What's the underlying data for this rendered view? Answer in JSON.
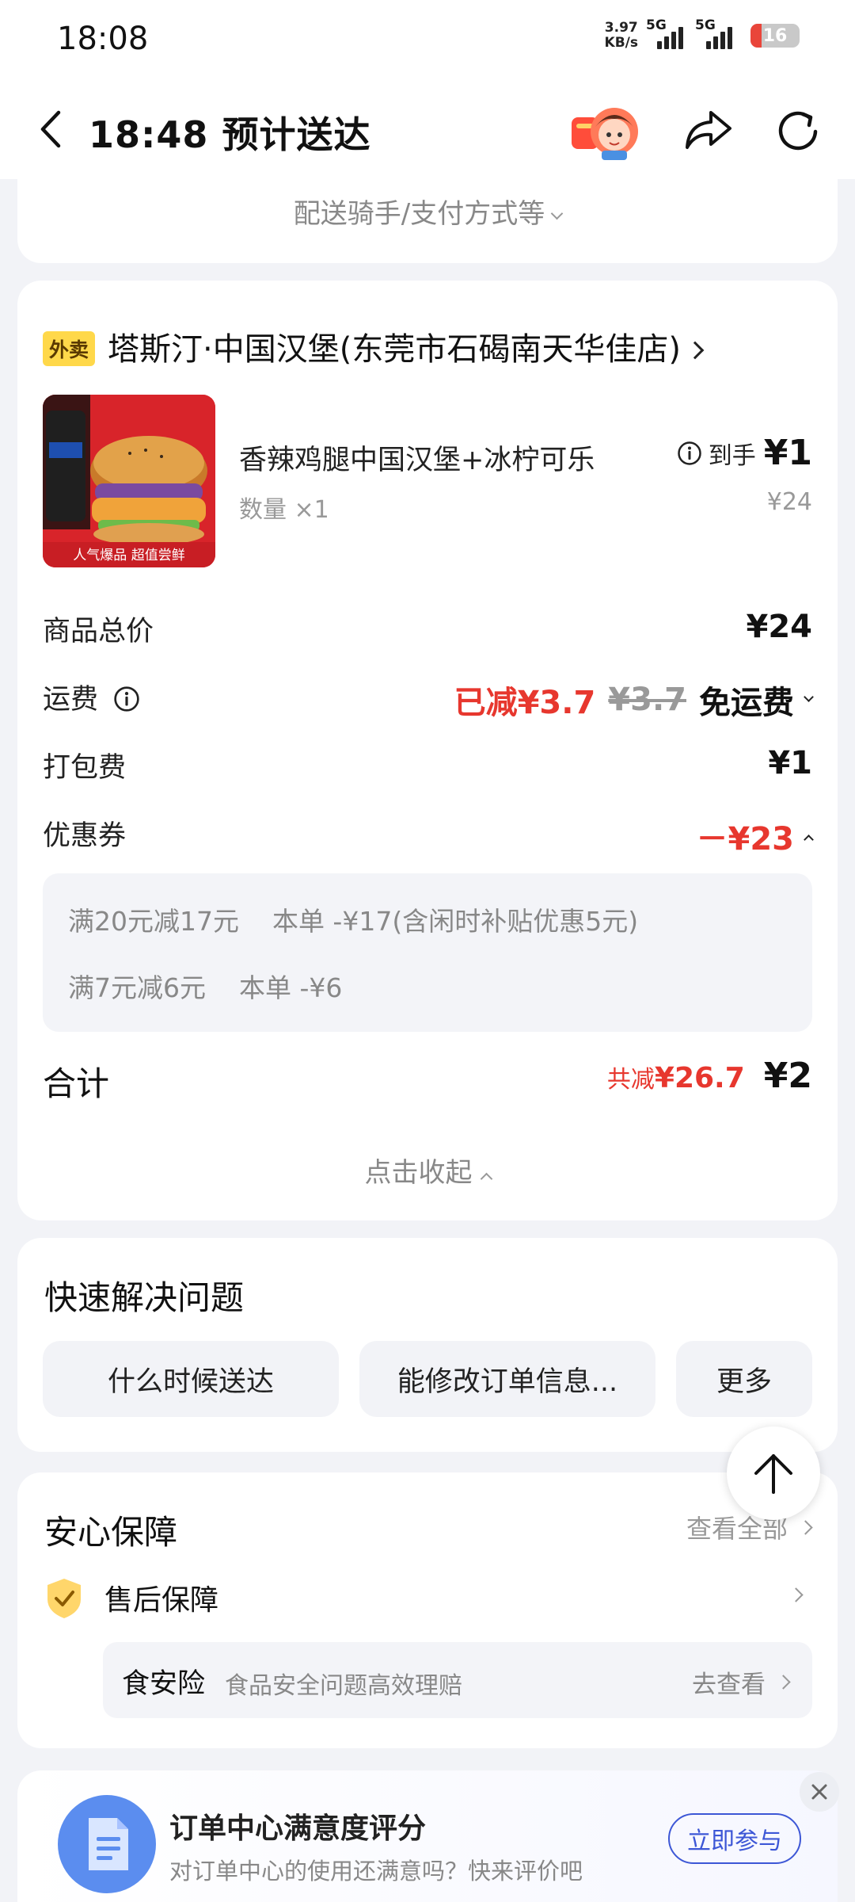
{
  "status_bar": {
    "time": "18:08",
    "net_speed_value": "3.97",
    "net_speed_unit": "KB/s",
    "signal_1": "5G",
    "signal_2": "5G",
    "battery": "16"
  },
  "header": {
    "title": "18:48 预计送达"
  },
  "delivery_info": {
    "more_label": "配送骑手/支付方式等"
  },
  "order": {
    "tag": "外卖",
    "store_name": "塔斯汀·中国汉堡(东莞市石碣南天华佳店)",
    "product": {
      "name": "香辣鸡腿中国汉堡+冰柠可乐",
      "quantity": "数量 ×1",
      "final_label": "到手",
      "final_price": "¥1",
      "original_price": "¥24",
      "image_badge": "人气爆品 超值尝鲜"
    },
    "rows": {
      "subtotal_label": "商品总价",
      "subtotal_value": "¥24",
      "delivery_label": "运费",
      "delivery_saved": "已减¥3.7",
      "delivery_orig": "¥3.7",
      "delivery_free": "免运费",
      "packing_label": "打包费",
      "packing_value": "¥1",
      "coupon_label": "优惠券",
      "coupon_value": "－¥23"
    },
    "coupons": [
      "满20元减17元    本单 -¥17(含闲时补贴优惠5元)",
      "满7元减6元    本单 -¥6"
    ],
    "total_label": "合计",
    "total_saved_prefix": "共减",
    "total_saved": "¥26.7",
    "total_amount": "¥2",
    "collapse_label": "点击收起"
  },
  "quick_help": {
    "title": "快速解决问题",
    "buttons": [
      "什么时候送达",
      "能修改订单信息...",
      "更多"
    ]
  },
  "safety": {
    "title": "安心保障",
    "view_all": "查看全部",
    "aftersale": "售后保障",
    "food_title": "食安险",
    "food_desc": "食品安全问题高效理赔",
    "food_go": "去查看"
  },
  "survey": {
    "title": "订单中心满意度评分",
    "desc": "对订单中心的使用还满意吗？快来评价吧",
    "button": "立即参与"
  },
  "colors": {
    "accent_red": "#e7372e",
    "tag_yellow": "#ffd84a",
    "survey_blue": "#3d57d6"
  }
}
